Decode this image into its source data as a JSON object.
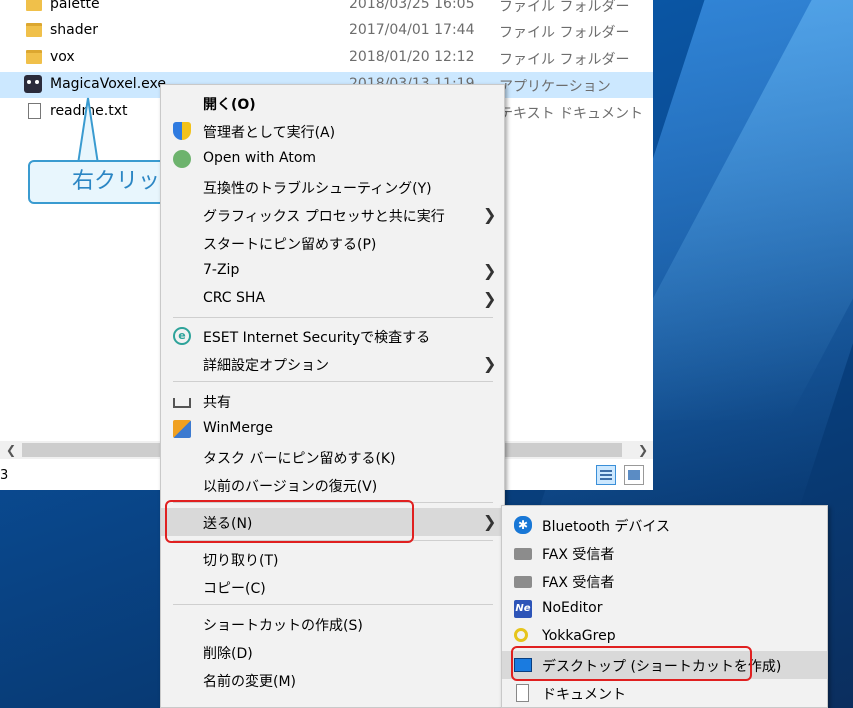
{
  "files": [
    {
      "name": "palette",
      "date": "2018/03/25 16:05",
      "type": "ファイル フォルダー",
      "icon": "folder-icon",
      "selected": false
    },
    {
      "name": "shader",
      "date": "2017/04/01 17:44",
      "type": "ファイル フォルダー",
      "icon": "folder-icon",
      "selected": false
    },
    {
      "name": "vox",
      "date": "2018/01/20 12:12",
      "type": "ファイル フォルダー",
      "icon": "folder-icon",
      "selected": false
    },
    {
      "name": "MagicaVoxel.exe",
      "date": "2018/03/13 11:19",
      "type": "アプリケーション",
      "icon": "exe-icon",
      "selected": true
    },
    {
      "name": "readme.txt",
      "date": "",
      "type": "テキスト ドキュメント",
      "icon": "txt-icon",
      "selected": false
    }
  ],
  "status": {
    "count": "3"
  },
  "callout": {
    "text": "右クリック"
  },
  "context_menu": {
    "open": "開く(O)",
    "run_as_admin": "管理者として実行(A)",
    "open_with_atom": "Open with Atom",
    "compat_troubleshoot": "互換性のトラブルシューティング(Y)",
    "graphics_processor": "グラフィックス プロセッサと共に実行",
    "pin_start": "スタートにピン留めする(P)",
    "seven_zip": "7-Zip",
    "crc_sha": "CRC SHA",
    "eset_scan": "ESET Internet Securityで検査する",
    "advanced_options": "詳細設定オプション",
    "share": "共有",
    "winmerge": "WinMerge",
    "pin_taskbar": "タスク バーにピン留めする(K)",
    "restore_previous": "以前のバージョンの復元(V)",
    "send_to": "送る(N)",
    "cut": "切り取り(T)",
    "copy": "コピー(C)",
    "create_shortcut": "ショートカットの作成(S)",
    "delete": "削除(D)",
    "rename": "名前の変更(M)"
  },
  "send_to_menu": {
    "bluetooth": "Bluetooth デバイス",
    "fax1": "FAX 受信者",
    "fax2": "FAX 受信者",
    "noeditor": "NoEditor",
    "yokkagrep": "YokkaGrep",
    "desktop_shortcut": "デスクトップ (ショートカットを作成)",
    "documents": "ドキュメント"
  },
  "colors": {
    "highlight": "#d9d9d9",
    "selection": "#cce8ff",
    "annotation_red": "#e02020",
    "callout_blue": "#3a9bd0"
  }
}
